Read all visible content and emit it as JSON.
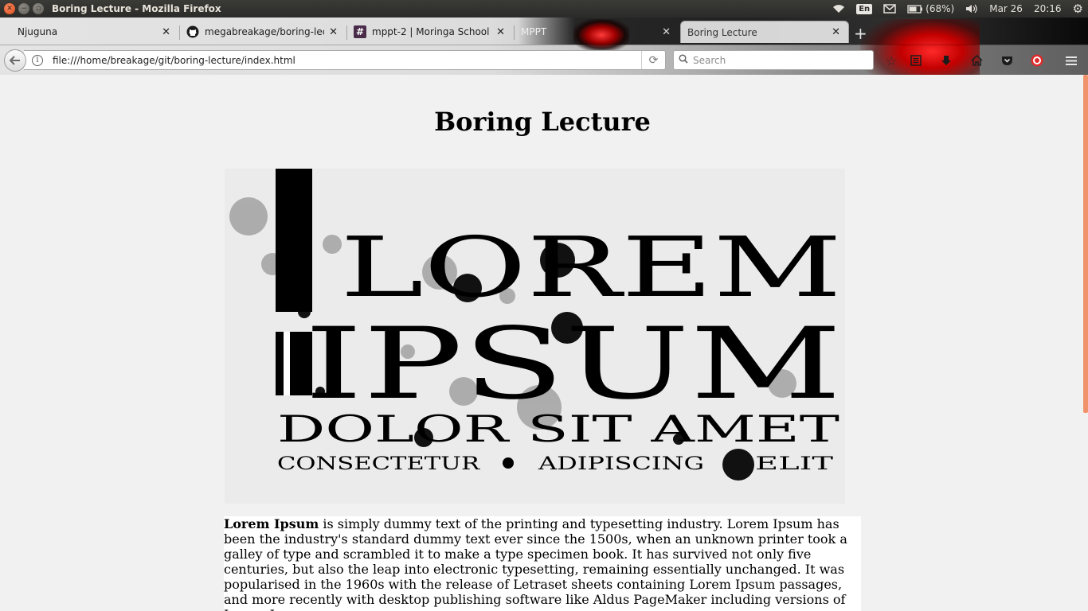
{
  "panel": {
    "window_title": "Boring Lecture - Mozilla Firefox",
    "keyboard_layout": "En",
    "battery": "(68%)",
    "date": "Mar 26",
    "time": "20:16"
  },
  "tabs": [
    {
      "label": "Njuguna",
      "favicon": "none",
      "active": false
    },
    {
      "label": "megabreakage/boring-lec…",
      "favicon": "github-icon",
      "active": false
    },
    {
      "label": "mppt-2 | Moringa School S…",
      "favicon": "hash-icon",
      "active": false
    },
    {
      "label": "MPPT",
      "favicon": "none",
      "active": false
    },
    {
      "label": "Boring Lecture",
      "favicon": "none",
      "active": true
    }
  ],
  "navbar": {
    "url": "file:///home/breakage/git/boring-lecture/index.html",
    "search_placeholder": "Search"
  },
  "page": {
    "title": "Boring Lecture",
    "hero_image": {
      "line1": "LOREM",
      "line2": "IPSUM",
      "line3": "DOLOR SIT AMET",
      "line4a": "CONSECTETUR",
      "line4b": "ADIPISCING",
      "line4c": "ELIT"
    },
    "article_lead": "Lorem Ipsum",
    "article_body": " is simply dummy text of the printing and typesetting industry. Lorem Ipsum has been the industry's standard dummy text ever since the 1500s, when an unknown printer took a galley of type and scrambled it to make a type specimen book. It has survived not only five centuries, but also the leap into electronic typesetting, remaining essentially unchanged. It was popularised in the 1960s with the release of Letraset sheets containing Lorem Ipsum passages, and more recently with desktop publishing software like Aldus PageMaker including versions of Lorem Ipsum."
  },
  "colors": {
    "scrollbar_thumb": "#f0936b",
    "close_button": "#df4b16"
  }
}
